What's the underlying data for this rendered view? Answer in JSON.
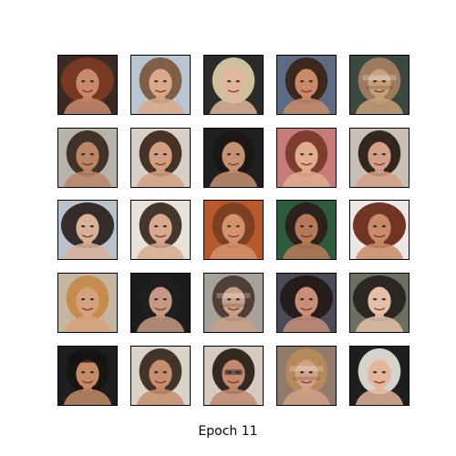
{
  "caption": "Epoch 11",
  "grid": {
    "rows": 5,
    "cols": 5
  },
  "samples": [
    {
      "bg": "#3a2a24",
      "hair": "#7a3a22",
      "skin": "#c98a6c",
      "tone": "dark-curly"
    },
    {
      "bg": "#b9c6d1",
      "hair": "#7b5a3e",
      "skin": "#d9a98b",
      "tone": "light"
    },
    {
      "bg": "#2b2b2b",
      "hair": "#d8c8a2",
      "skin": "#e0b79a",
      "tone": "blonde"
    },
    {
      "bg": "#5c6b84",
      "hair": "#3a2418",
      "skin": "#c98a6a",
      "tone": "dark"
    },
    {
      "bg": "#3b4840",
      "hair": "#a08060",
      "skin": "#c9a07a",
      "tone": "glitch"
    },
    {
      "bg": "#b8b2ac",
      "hair": "#3b2a20",
      "skin": "#b88566",
      "tone": "dark"
    },
    {
      "bg": "#d7d0c8",
      "hair": "#3e2a1e",
      "skin": "#d2a081",
      "tone": "brunette"
    },
    {
      "bg": "#1f1f22",
      "hair": "#1d1714",
      "skin": "#c49270",
      "tone": "dark"
    },
    {
      "bg": "#c77b7b",
      "hair": "#7b3a2a",
      "skin": "#e2ad8f",
      "tone": "red"
    },
    {
      "bg": "#c8c0b6",
      "hair": "#2a1d17",
      "skin": "#d2a086",
      "tone": "dark"
    },
    {
      "bg": "#b9c3cf",
      "hair": "#2c2520",
      "skin": "#d8b199",
      "tone": "dark-curly"
    },
    {
      "bg": "#e7e2da",
      "hair": "#3b2c24",
      "skin": "#d7aa8f",
      "tone": "short"
    },
    {
      "bg": "#b85a2a",
      "hair": "#6a3a22",
      "skin": "#d8a07a",
      "tone": "red-bg"
    },
    {
      "bg": "#2c5a3c",
      "hair": "#2b1e18",
      "skin": "#b77a58",
      "tone": "male"
    },
    {
      "bg": "#ece7e2",
      "hair": "#6b2a18",
      "skin": "#c98a67",
      "tone": "curly"
    },
    {
      "bg": "#c5b6a0",
      "hair": "#c58a4a",
      "skin": "#d6a27c",
      "tone": "blonde"
    },
    {
      "bg": "#1c1c1c",
      "hair": "#202020",
      "skin": "#c49a84",
      "tone": "dark"
    },
    {
      "bg": "#a7a19b",
      "hair": "#4a3a30",
      "skin": "#c8a08a",
      "tone": "glitch"
    },
    {
      "bg": "#4a4a58",
      "hair": "#241a18",
      "skin": "#c98e78",
      "tone": "dark-curly"
    },
    {
      "bg": "#6a7060",
      "hair": "#2a2220",
      "skin": "#e5c0a8",
      "tone": "curly"
    },
    {
      "bg": "#1e1e22",
      "hair": "#1a1410",
      "skin": "#c48a66",
      "tone": "hat"
    },
    {
      "bg": "#d9d3ca",
      "hair": "#3b2a20",
      "skin": "#c58e6c",
      "tone": "dark"
    },
    {
      "bg": "#d6c9c0",
      "hair": "#2b201a",
      "skin": "#c08970",
      "tone": "glasses"
    },
    {
      "bg": "#8f7a6b",
      "hair": "#b78a5a",
      "skin": "#d2a286",
      "tone": "glitch"
    },
    {
      "bg": "#1e1e1e",
      "hair": "#e2dcd4",
      "skin": "#e3b59a",
      "tone": "light"
    }
  ]
}
